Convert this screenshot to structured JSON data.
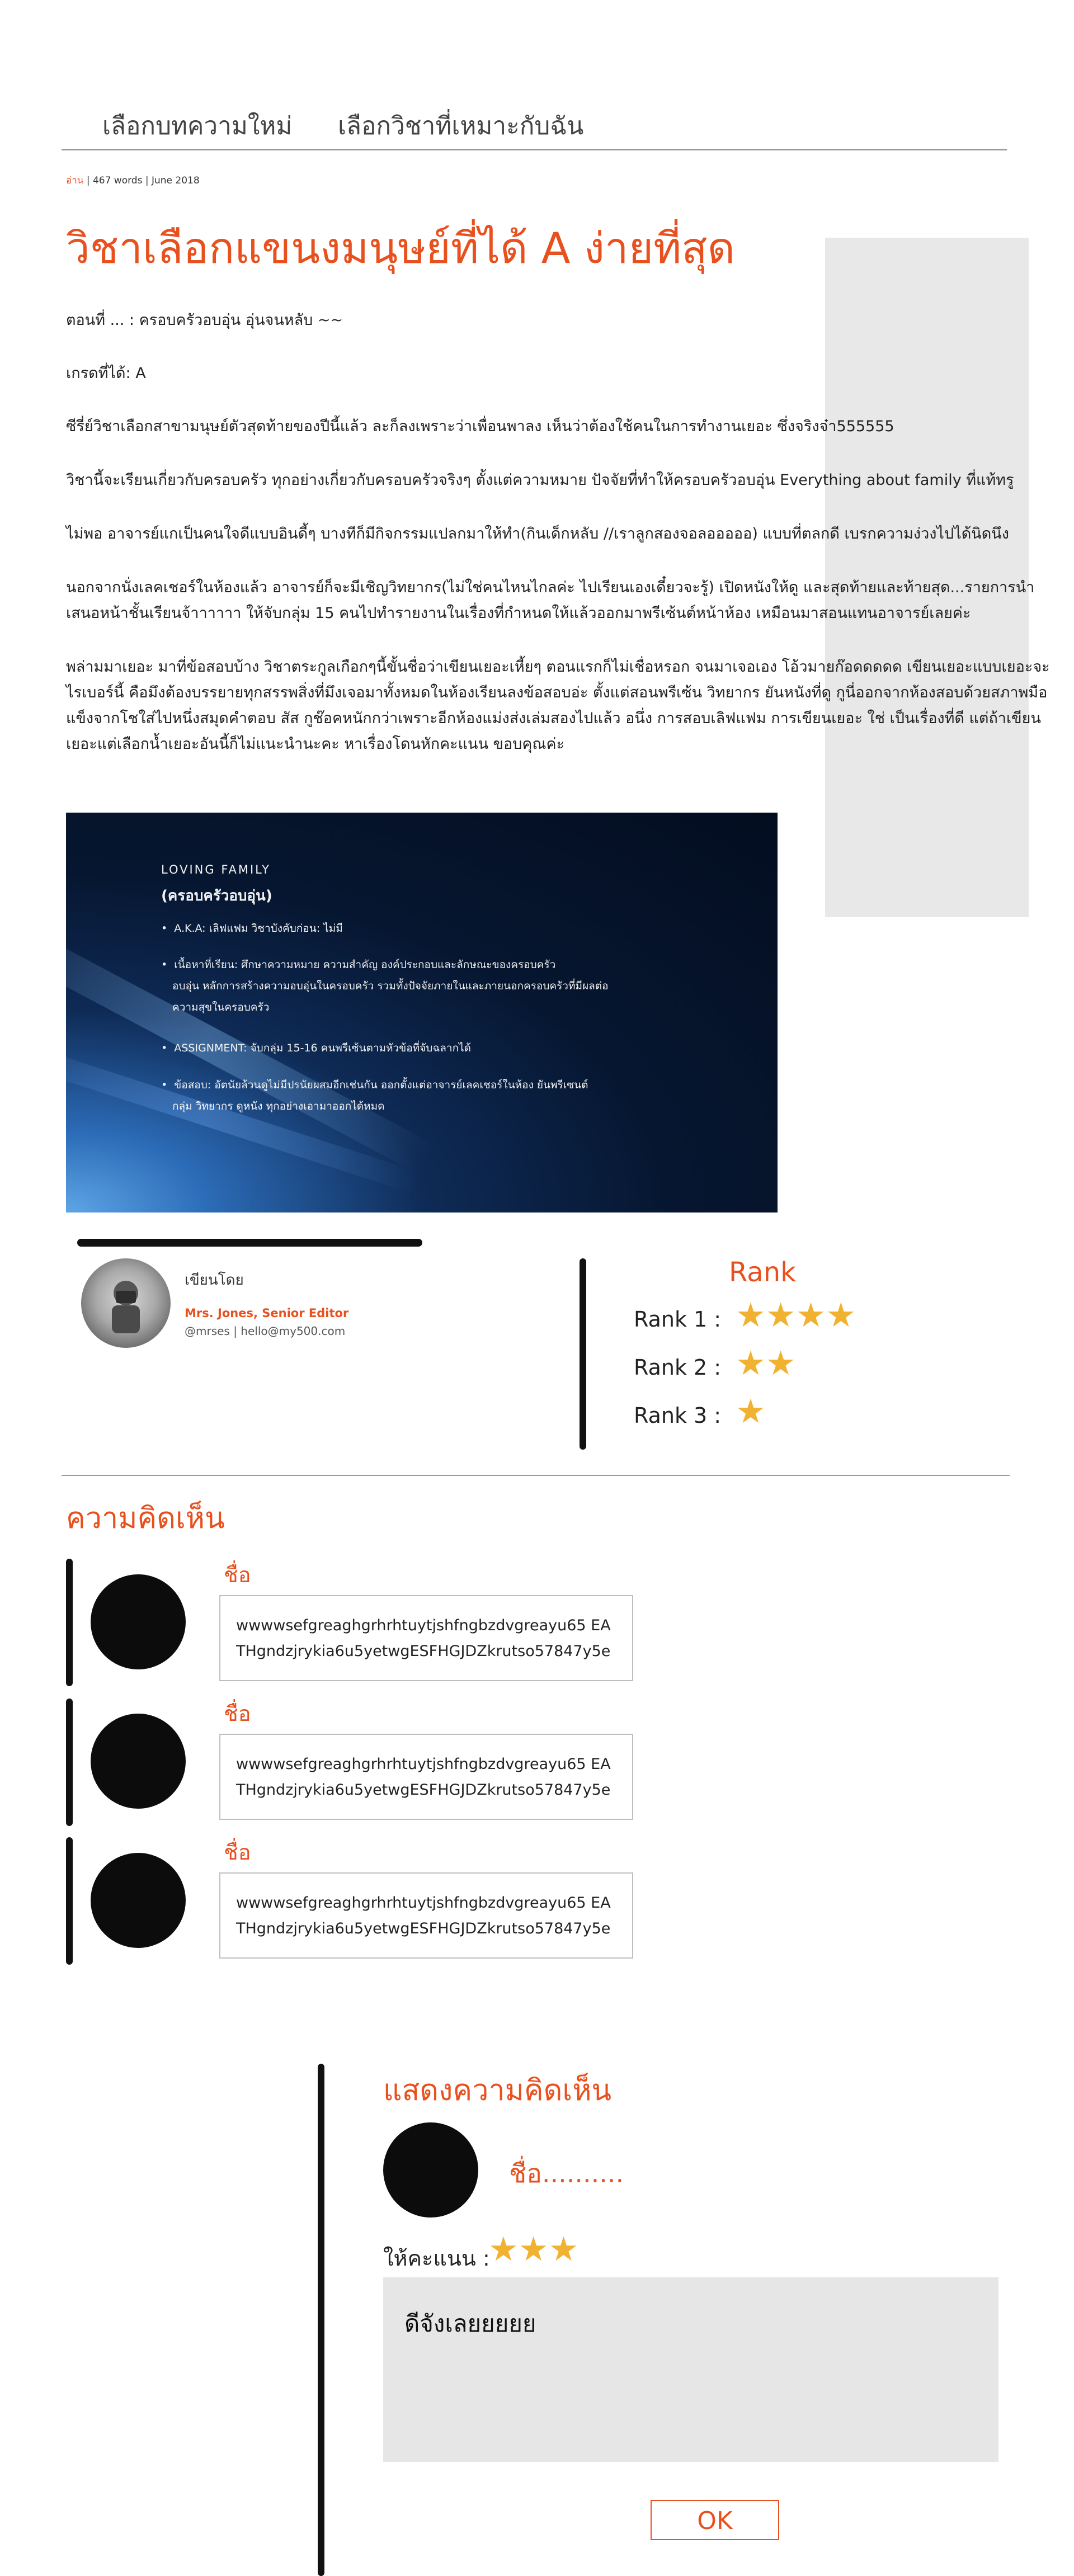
{
  "nav": {
    "items": [
      "เลือกบทความใหม่",
      "เลือกวิชาที่เหมาะกับฉัน"
    ]
  },
  "meta": {
    "category": "อ่าน",
    "words": "467 words",
    "date": "June 2018"
  },
  "article": {
    "title": "วิชาเลือกแขนงมนุษย์ที่ได้ A ง่ายที่สุด",
    "paragraphs": [
      "ตอนที่ ... : ครอบครัวอบอุ่น อุ่นจนหลับ ~~",
      "เกรดที่ได้: A",
      "ซีรี่ย์วิชาเลือกสาขามนุษย์ตัวสุดท้ายของปีนี้แล้ว ละก็ลงเพราะว่าเพื่อนพาลง เห็นว่าต้องใช้คนในการทำงานเยอะ ซึ่งจริงจ๋า555555",
      "วิชานี้จะเรียนเกี่ยวกับครอบครัว ทุกอย่างเกี่ยวกับครอบครัวจริงๆ ตั้งแต่ความหมาย ปัจจัยที่ทำให้ครอบครัวอบอุ่น Everything about family ที่แท้ทรู",
      "ไม่พอ อาจารย์แกเป็นคนใจดีแบบอินดี้ๆ บางทีก็มีกิจกรรมแปลกมาให้ทำ(กินเด็กหลับ //เราลูกสองจอลอออออ) แบบที่ตลกดี เบรกความง่วงไปได้นิดนึง",
      "นอกจากนั่งเลคเชอร์ในห้องแล้ว อาจารย์ก็จะมีเชิญวิทยากร(ไม่ใช่คนไหนไกลค่ะ ไปเรียนเองเดี๋ยวจะรู้) เปิดหนังให้ดู และสุดท้ายและท้ายสุด...รายการนำเสนอหน้าชั้นเรียนจ้าาาาาา ให้จับกลุ่ม 15 คนไปทำรายงานในเรื่องที่กำหนดให้แล้วออกมาพรีเซ้นต์หน้าห้อง เหมือนมาสอนแทนอาจารย์เลยค่ะ",
      "พล่ามมาเยอะ มาที่ข้อสอบบ้าง วิชาตระกูลเกือกๆนี้ขั้นชื่อว่าเขียนเยอะเหี้ยๆ ตอนแรกก็ไม่เชื่อหรอก จนมาเจอเอง โอ้วมายก๊อดดดดด เขียนเยอะแบบเยอะจะไรเบอร์นี้ คือมึงต้องบรรยายทุกสรรพสิ่งที่มึงเจอมาทั้งหมดในห้องเรียนลงข้อสอบอ่ะ ตั้งแต่สอนพรีเซ้น วิทยากร ยันหนังที่ดู กูนี่ออกจากห้องสอบด้วยสภาพมือแข็งจากโชใส่ไปหนึ่งสมุดคำตอบ สัส กูช๊อคหนักกว่าเพราะอีกห้องแม่งส่งเล่มสองไปแล้ว อนึ่ง การสอบเลิฟแฟม การเขียนเยอะ ใช่ เป็นเรื่องที่ดี แต่ถ้าเขียนเยอะแต่เลือกน้ำเยอะอันนี้ก็ไม่แนะนำนะคะ หาเรื่องโดนหักคะแนน ขอบคุณค่ะ"
    ]
  },
  "hero": {
    "title_en": "LOVING FAMILY",
    "title_th": "(ครอบครัวอบอุ่น)",
    "bullets": [
      "A.K.A: เลิฟแฟม                         วิชาบังคับก่อน: ไม่มี",
      "เนื้อหาที่เรียน: ศึกษาความหมาย  ความสำคัญ  องค์ประกอบและลักษณะของครอบครัว",
      "อบอุ่น  หลักการสร้างความอบอุ่นในครอบครัว  รวมทั้งปัจจัยภายในและภายนอกครอบครัวที่มีผลต่อ",
      "ความสุขในครอบครัว",
      "ASSIGNMENT: จับกลุ่ม 15-16  คนพรีเซ้นตามหัวข้อที่จับฉลากได้",
      "ข้อสอบ: อัตนัยล้วนดูไม่มีปรนัยผสมอีกเช่นกัน  ออกตั้งแต่อาจารย์เลคเชอร์ในห้อง  ยันพรีเซนต์",
      "กลุ่ม วิทยากร ดูหนัง ทุกอย่างเอามาออกได้หมด"
    ]
  },
  "author": {
    "label": "เขียนโดย",
    "name": "Mrs. Jones, Senior Editor",
    "contact": "@mrses | hello@my500.com"
  },
  "rank": {
    "title": "Rank",
    "rows": [
      {
        "label": "Rank 1  :",
        "stars": 4
      },
      {
        "label": "Rank 2  :",
        "stars": 2
      },
      {
        "label": "Rank 3  :",
        "stars": 1
      }
    ]
  },
  "comments": {
    "heading": "ความคิดเห็น",
    "items": [
      {
        "name": "ชื่อ",
        "text": "wwwwsefgreaghgrhrhtuytjshfngbzdvgreayu65 EATHgndzjrykia6u5yetwgESFHGJDZkrutso57847y5e"
      },
      {
        "name": "ชื่อ",
        "text": "wwwwsefgreaghgrhrhtuytjshfngbzdvgreayu65 EATHgndzjrykia6u5yetwgESFHGJDZkrutso57847y5e"
      },
      {
        "name": "ชื่อ",
        "text": "wwwwsefgreaghgrhrhtuytjshfngbzdvgreayu65 EATHgndzjrykia6u5yetwgESFHGJDZkrutso57847y5e"
      }
    ]
  },
  "write_comment": {
    "heading": "แสดงความคิดเห็น",
    "name_placeholder": "ชื่อ..........",
    "rating_label": "ให้คะแนน  :",
    "rating": 3,
    "text": "ดีจังเลยยยยย",
    "ok_label": "OK"
  },
  "colors": {
    "accent": "#e8501e",
    "star": "#f0b230",
    "ad_box": "#e8e8e8"
  }
}
